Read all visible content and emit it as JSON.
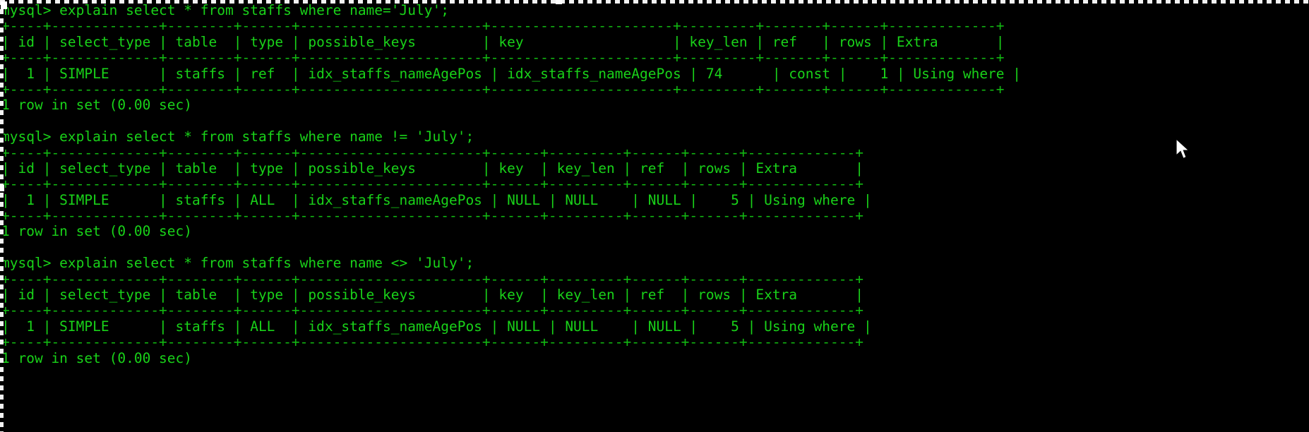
{
  "terminal": {
    "prompt": "mysql>",
    "foreground_color": "#19d219",
    "background_color": "#000000",
    "selection_border_color": "#ffffff",
    "cursor_color": "#ffffff"
  },
  "blocks": [
    {
      "command_line": "mysql> explain select * from staffs where name='July';",
      "result_status": "1 row in set (0.00 sec)",
      "table": {
        "top_rule": "+----+-------------+--------+------+----------------------+----------------------+---------+-------+------+-------------+",
        "header_row": "| id | select_type | table  | type | possible_keys        | key                  | key_len | ref   | rows | Extra       |",
        "mid_rule": "+----+-------------+--------+------+----------------------+----------------------+---------+-------+------+-------------+",
        "data_row": "|  1 | SIMPLE      | staffs | ref  | idx_staffs_nameAgePos | idx_staffs_nameAgePos | 74      | const |    1 | Using where |",
        "bottom_rule": "+----+-------------+--------+------+----------------------+----------------------+---------+-------+------+-------------+",
        "columns": [
          "id",
          "select_type",
          "table",
          "type",
          "possible_keys",
          "key",
          "key_len",
          "ref",
          "rows",
          "Extra"
        ],
        "rows": [
          {
            "id": "1",
            "select_type": "SIMPLE",
            "table": "staffs",
            "type": "ref",
            "possible_keys": "idx_staffs_nameAgePos",
            "key": "idx_staffs_nameAgePos",
            "key_len": "74",
            "ref": "const",
            "rows": "1",
            "Extra": "Using where"
          }
        ]
      }
    },
    {
      "command_line": "mysql> explain select * from staffs where name != 'July';",
      "result_status": "1 row in set (0.00 sec)",
      "table": {
        "top_rule": "+----+-------------+--------+------+----------------------+------+---------+------+------+-------------+",
        "header_row": "| id | select_type | table  | type | possible_keys        | key  | key_len | ref  | rows | Extra       |",
        "mid_rule": "+----+-------------+--------+------+----------------------+------+---------+------+------+-------------+",
        "data_row": "|  1 | SIMPLE      | staffs | ALL  | idx_staffs_nameAgePos | NULL | NULL    | NULL |    5 | Using where |",
        "bottom_rule": "+----+-------------+--------+------+----------------------+------+---------+------+------+-------------+",
        "columns": [
          "id",
          "select_type",
          "table",
          "type",
          "possible_keys",
          "key",
          "key_len",
          "ref",
          "rows",
          "Extra"
        ],
        "rows": [
          {
            "id": "1",
            "select_type": "SIMPLE",
            "table": "staffs",
            "type": "ALL",
            "possible_keys": "idx_staffs_nameAgePos",
            "key": "NULL",
            "key_len": "NULL",
            "ref": "NULL",
            "rows": "5",
            "Extra": "Using where"
          }
        ]
      }
    },
    {
      "command_line": "mysql> explain select * from staffs where name <> 'July';",
      "result_status": "1 row in set (0.00 sec)",
      "table": {
        "top_rule": "+----+-------------+--------+------+----------------------+------+---------+------+------+-------------+",
        "header_row": "| id | select_type | table  | type | possible_keys        | key  | key_len | ref  | rows | Extra       |",
        "mid_rule": "+----+-------------+--------+------+----------------------+------+---------+------+------+-------------+",
        "data_row": "|  1 | SIMPLE      | staffs | ALL  | idx_staffs_nameAgePos | NULL | NULL    | NULL |    5 | Using where |",
        "bottom_rule": "+----+-------------+--------+------+----------------------+------+---------+------+------+-------------+",
        "columns": [
          "id",
          "select_type",
          "table",
          "type",
          "possible_keys",
          "key",
          "key_len",
          "ref",
          "rows",
          "Extra"
        ],
        "rows": [
          {
            "id": "1",
            "select_type": "SIMPLE",
            "table": "staffs",
            "type": "ALL",
            "possible_keys": "idx_staffs_nameAgePos",
            "key": "NULL",
            "key_len": "NULL",
            "ref": "NULL",
            "rows": "5",
            "Extra": "Using where"
          }
        ]
      }
    }
  ],
  "final_partial_line": "1 row in set (0.00 sec)"
}
